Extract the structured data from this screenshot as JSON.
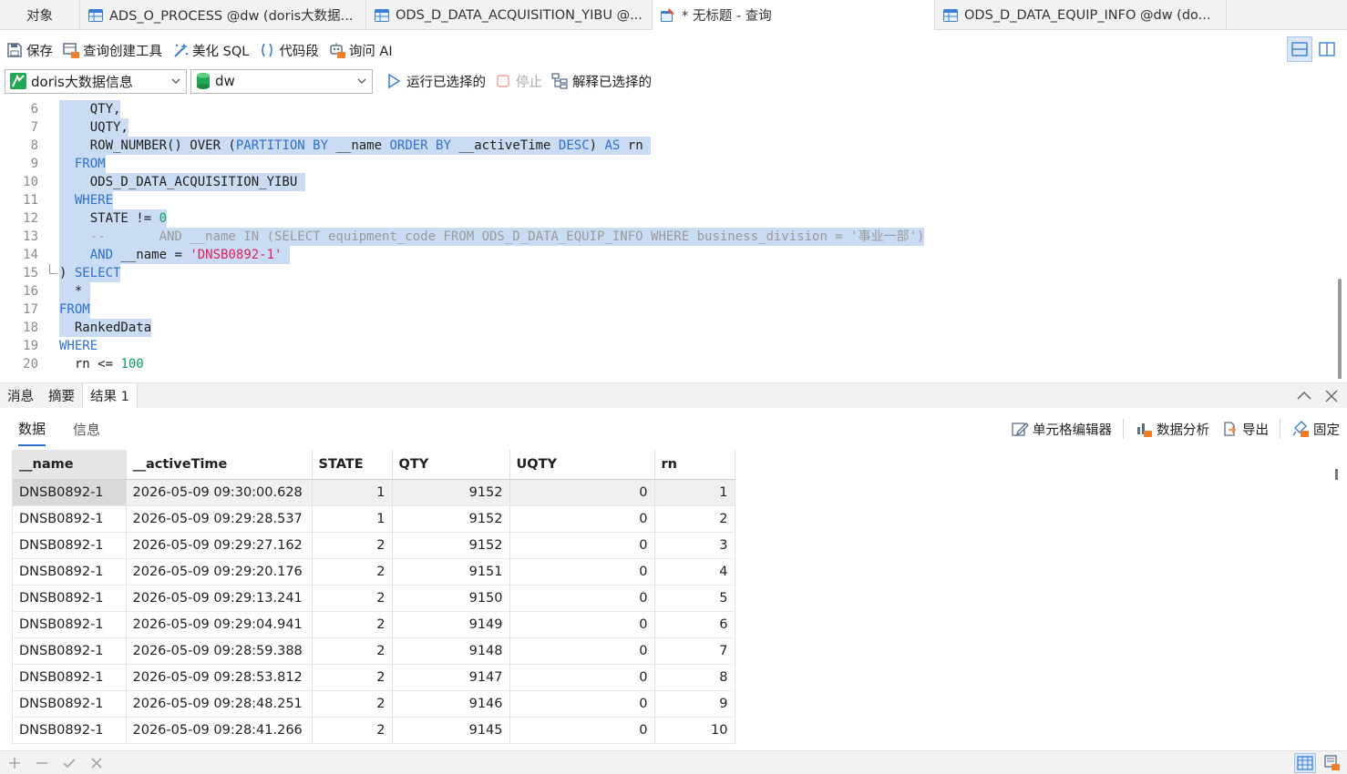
{
  "tabs": [
    {
      "label": "对象",
      "icon": "none-icon",
      "active": false
    },
    {
      "label": "ADS_O_PROCESS @dw (doris大数据...",
      "icon": "table-icon",
      "active": false
    },
    {
      "label": "ODS_D_DATA_ACQUISITION_YIBU @...",
      "icon": "table-icon",
      "active": false
    },
    {
      "label": "* 无标题 - 查询",
      "icon": "query-icon",
      "active": true
    },
    {
      "label": "ODS_D_DATA_EQUIP_INFO @dw (do...",
      "icon": "table-icon",
      "active": false
    }
  ],
  "toolbar": {
    "save": "保存",
    "query_builder": "查询创建工具",
    "beautify": "美化 SQL",
    "snippet": "代码段",
    "ask_ai": "询问 AI"
  },
  "connection": {
    "server": "doris大数据信息",
    "database": "dw",
    "run_selected": "运行已选择的",
    "stop": "停止",
    "explain_selected": "解释已选择的"
  },
  "editor": {
    "lines": [
      {
        "n": "6",
        "segments": [
          {
            "t": "    QTY,",
            "c": ""
          }
        ],
        "sel": true
      },
      {
        "n": "7",
        "segments": [
          {
            "t": "    UQTY,",
            "c": ""
          }
        ],
        "sel": true
      },
      {
        "n": "8",
        "segments": [
          {
            "t": "    ROW_NUMBER() OVER (",
            "c": ""
          },
          {
            "t": "PARTITION BY",
            "c": "kw"
          },
          {
            "t": " __name ",
            "c": ""
          },
          {
            "t": "ORDER BY",
            "c": "kw"
          },
          {
            "t": " __activeTime ",
            "c": ""
          },
          {
            "t": "DESC",
            "c": "kw"
          },
          {
            "t": ") ",
            "c": ""
          },
          {
            "t": "AS",
            "c": "kw"
          },
          {
            "t": " rn ",
            "c": ""
          }
        ],
        "sel": true
      },
      {
        "n": "9",
        "segments": [
          {
            "t": "  ",
            "c": ""
          },
          {
            "t": "FROM",
            "c": "kw"
          }
        ],
        "sel": true
      },
      {
        "n": "10",
        "segments": [
          {
            "t": "    ODS_D_DATA_ACQUISITION_YIBU ",
            "c": ""
          }
        ],
        "sel": true
      },
      {
        "n": "11",
        "segments": [
          {
            "t": "  ",
            "c": ""
          },
          {
            "t": "WHERE",
            "c": "kw"
          }
        ],
        "sel": true
      },
      {
        "n": "12",
        "segments": [
          {
            "t": "    STATE != ",
            "c": ""
          },
          {
            "t": "0",
            "c": "num"
          }
        ],
        "sel": true
      },
      {
        "n": "13",
        "segments": [
          {
            "t": "    --       AND __name IN (SELECT equipment_code FROM ODS_D_DATA_EQUIP_INFO WHERE business_division = '事业一部')",
            "c": "cmt"
          }
        ],
        "sel": true
      },
      {
        "n": "14",
        "segments": [
          {
            "t": "    ",
            "c": ""
          },
          {
            "t": "AND",
            "c": "kw"
          },
          {
            "t": " __name = ",
            "c": ""
          },
          {
            "t": "'DNSB0892-1'",
            "c": "str"
          },
          {
            "t": " ",
            "c": ""
          }
        ],
        "sel": true
      },
      {
        "n": "15",
        "segments": [
          {
            "t": ") ",
            "c": ""
          },
          {
            "t": "SELECT",
            "c": "kw"
          }
        ],
        "sel": true,
        "fold": true
      },
      {
        "n": "16",
        "segments": [
          {
            "t": "  * ",
            "c": ""
          }
        ],
        "sel": true
      },
      {
        "n": "17",
        "segments": [
          {
            "t": "FROM",
            "c": "kw"
          }
        ],
        "sel": true
      },
      {
        "n": "18",
        "segments": [
          {
            "t": "  RankedData",
            "c": ""
          }
        ],
        "sel": true
      },
      {
        "n": "19",
        "segments": [
          {
            "t": "WHERE",
            "c": "kw"
          }
        ],
        "sel": false
      },
      {
        "n": "20",
        "segments": [
          {
            "t": "  rn <= ",
            "c": ""
          },
          {
            "t": "100",
            "c": "num"
          }
        ],
        "sel": false
      }
    ]
  },
  "result_panel": {
    "tabs": [
      "消息",
      "摘要",
      "结果 1"
    ],
    "active_tab": "结果 1",
    "subtabs": [
      "数据",
      "信息"
    ],
    "active_subtab": "数据",
    "tools": {
      "cell_editor": "单元格编辑器",
      "data_analysis": "数据分析",
      "export": "导出",
      "pin": "固定"
    }
  },
  "grid": {
    "columns": [
      "__name",
      "__activeTime",
      "STATE",
      "QTY",
      "UQTY",
      "rn"
    ],
    "rows": [
      [
        "DNSB0892-1",
        "2026-05-09 09:30:00.628",
        "1",
        "9152",
        "0",
        "1"
      ],
      [
        "DNSB0892-1",
        "2026-05-09 09:29:28.537",
        "1",
        "9152",
        "0",
        "2"
      ],
      [
        "DNSB0892-1",
        "2026-05-09 09:29:27.162",
        "2",
        "9152",
        "0",
        "3"
      ],
      [
        "DNSB0892-1",
        "2026-05-09 09:29:20.176",
        "2",
        "9151",
        "0",
        "4"
      ],
      [
        "DNSB0892-1",
        "2026-05-09 09:29:13.241",
        "2",
        "9150",
        "0",
        "5"
      ],
      [
        "DNSB0892-1",
        "2026-05-09 09:29:04.941",
        "2",
        "9149",
        "0",
        "6"
      ],
      [
        "DNSB0892-1",
        "2026-05-09 09:28:59.388",
        "2",
        "9148",
        "0",
        "7"
      ],
      [
        "DNSB0892-1",
        "2026-05-09 09:28:53.812",
        "2",
        "9147",
        "0",
        "8"
      ],
      [
        "DNSB0892-1",
        "2026-05-09 09:28:48.251",
        "2",
        "9146",
        "0",
        "9"
      ],
      [
        "DNSB0892-1",
        "2026-05-09 09:28:41.266",
        "2",
        "9145",
        "0",
        "10"
      ]
    ]
  },
  "colors": {
    "keyword": "#2f6fd0",
    "string": "#e01e5a",
    "number": "#0aa05a",
    "selection": "#c9dcf3"
  }
}
